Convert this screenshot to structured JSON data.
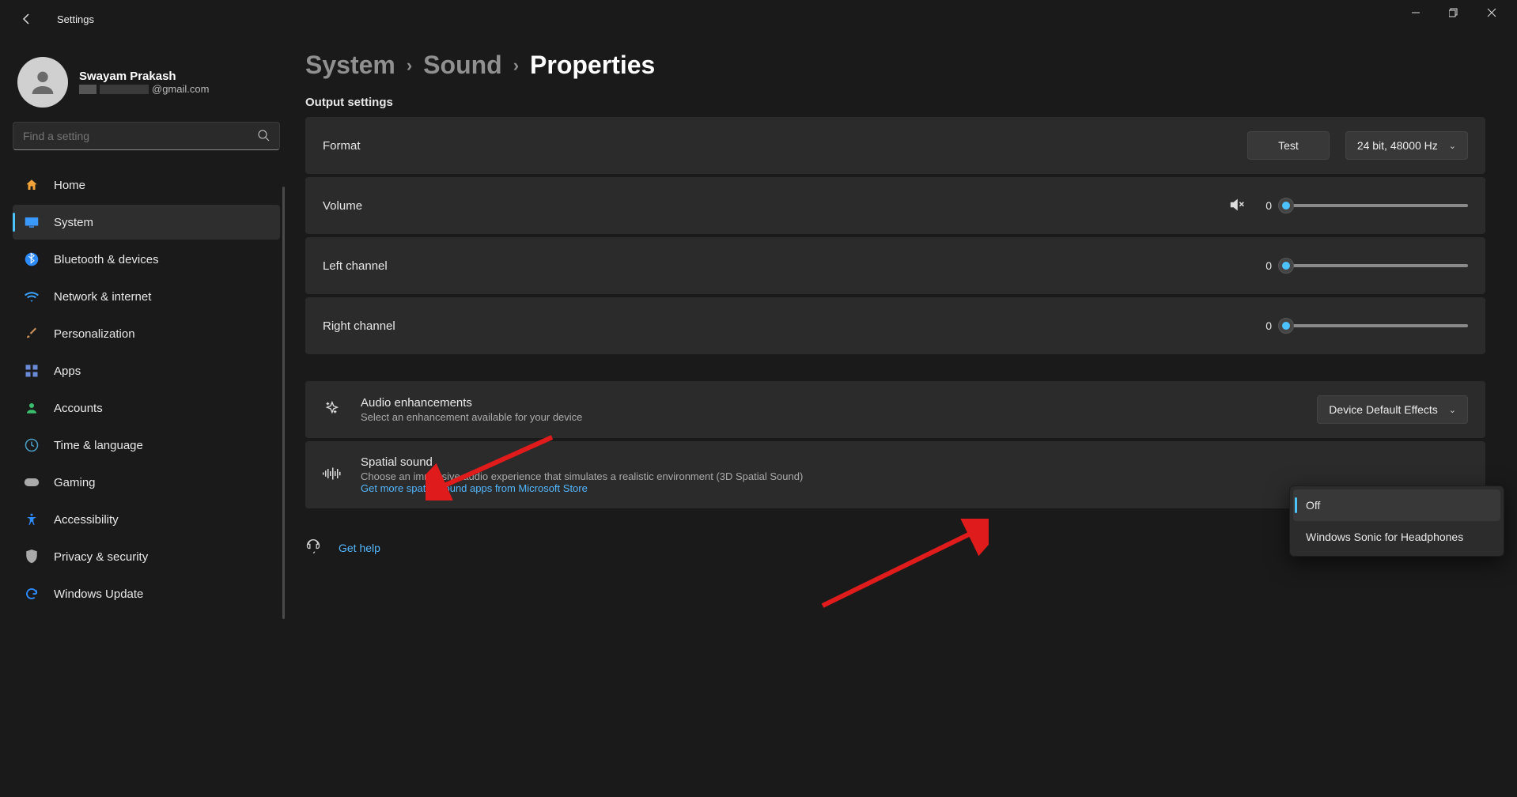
{
  "titlebar": {
    "title": "Settings"
  },
  "account": {
    "name": "Swayam Prakash",
    "email_suffix": "@gmail.com"
  },
  "search": {
    "placeholder": "Find a setting"
  },
  "nav": [
    {
      "label": "Home"
    },
    {
      "label": "System"
    },
    {
      "label": "Bluetooth & devices"
    },
    {
      "label": "Network & internet"
    },
    {
      "label": "Personalization"
    },
    {
      "label": "Apps"
    },
    {
      "label": "Accounts"
    },
    {
      "label": "Time & language"
    },
    {
      "label": "Gaming"
    },
    {
      "label": "Accessibility"
    },
    {
      "label": "Privacy & security"
    },
    {
      "label": "Windows Update"
    }
  ],
  "breadcrumb": {
    "system": "System",
    "sound": "Sound",
    "current": "Properties"
  },
  "output_section_title": "Output settings",
  "format": {
    "label": "Format",
    "test": "Test",
    "value": "24 bit, 48000 Hz"
  },
  "volume": {
    "label": "Volume",
    "value": "0"
  },
  "left": {
    "label": "Left channel",
    "value": "0"
  },
  "right": {
    "label": "Right channel",
    "value": "0"
  },
  "enhance": {
    "title": "Audio enhancements",
    "sub": "Select an enhancement available for your device",
    "dropdown": "Device Default Effects"
  },
  "spatial": {
    "title": "Spatial sound",
    "sub": "Choose an immersive audio experience that simulates a realistic environment (3D Spatial Sound)",
    "link": "Get more spatial sound apps from Microsoft Store"
  },
  "flyout": {
    "off": "Off",
    "sonic": "Windows Sonic for Headphones"
  },
  "help": {
    "label": "Get help"
  }
}
